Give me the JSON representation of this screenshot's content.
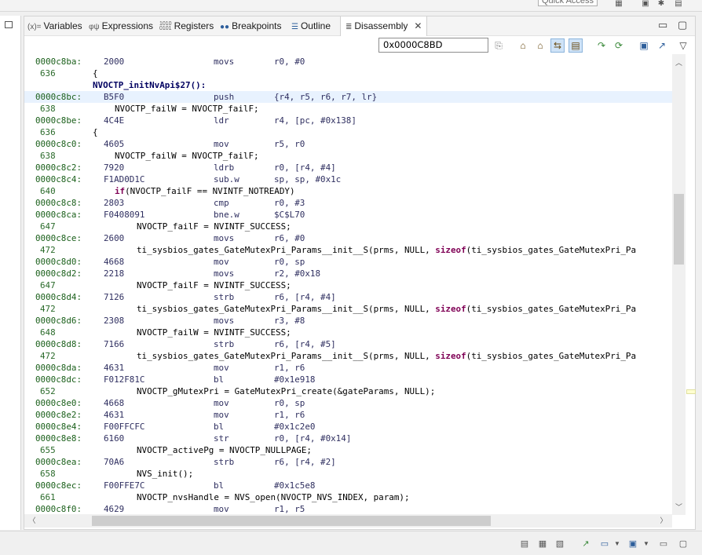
{
  "quick_access": {
    "placeholder": "Quick Access"
  },
  "tabs": [
    {
      "label": "Variables",
      "icon": "variables-icon",
      "glyph": "(x)="
    },
    {
      "label": "Expressions",
      "icon": "expressions-icon",
      "glyph": "φψ"
    },
    {
      "label": "Registers",
      "icon": "registers-icon",
      "glyph": "1010\n0101"
    },
    {
      "label": "Breakpoints",
      "icon": "breakpoints-icon",
      "glyph": "●●"
    },
    {
      "label": "Outline",
      "icon": "outline-icon",
      "glyph": "☰"
    },
    {
      "label": "Disassembly",
      "icon": "disassembly-icon",
      "glyph": "≣",
      "active": true
    }
  ],
  "address_input": {
    "value": "0x0000C8BD"
  },
  "disassembly": {
    "current_address": "0000c8bc:",
    "lines": [
      {
        "kind": "asm",
        "addr": "0000c8ba:",
        "opcode": "2000",
        "mnemonic": "movs",
        "operands": "r0, #0"
      },
      {
        "kind": "src",
        "lnum": "636",
        "code": "{",
        "indent": 0
      },
      {
        "kind": "func",
        "code": "NVOCTP_initNvApi$27():"
      },
      {
        "kind": "asm",
        "addr": "0000c8bc:",
        "opcode": "B5F0",
        "mnemonic": "push",
        "operands": "{r4, r5, r6, r7, lr}",
        "current": true
      },
      {
        "kind": "src",
        "lnum": "638",
        "code": "NVOCTP_failW = NVOCTP_failF;",
        "indent": 1
      },
      {
        "kind": "asm",
        "addr": "0000c8be:",
        "opcode": "4C4E",
        "mnemonic": "ldr",
        "operands": "r4, [pc, #0x138]"
      },
      {
        "kind": "src",
        "lnum": "636",
        "code": "{",
        "indent": 0
      },
      {
        "kind": "asm",
        "addr": "0000c8c0:",
        "opcode": "4605",
        "mnemonic": "mov",
        "operands": "r5, r0"
      },
      {
        "kind": "src",
        "lnum": "638",
        "code": "NVOCTP_failW = NVOCTP_failF;",
        "indent": 1
      },
      {
        "kind": "asm",
        "addr": "0000c8c2:",
        "opcode": "7920",
        "mnemonic": "ldrb",
        "operands": "r0, [r4, #4]"
      },
      {
        "kind": "asm",
        "addr": "0000c8c4:",
        "opcode": "F1AD0D1C",
        "mnemonic": "sub.w",
        "operands": "sp, sp, #0x1c"
      },
      {
        "kind": "src",
        "lnum": "640",
        "code": "if(NVOCTP_failF == NVINTF_NOTREADY)",
        "indent": 1,
        "kw": "if"
      },
      {
        "kind": "asm",
        "addr": "0000c8c8:",
        "opcode": "2803",
        "mnemonic": "cmp",
        "operands": "r0, #3"
      },
      {
        "kind": "asm",
        "addr": "0000c8ca:",
        "opcode": "F0408091",
        "mnemonic": "bne.w",
        "operands": "$C$L70"
      },
      {
        "kind": "src",
        "lnum": "647",
        "code": "NVOCTP_failF = NVINTF_SUCCESS;",
        "indent": 2
      },
      {
        "kind": "asm",
        "addr": "0000c8ce:",
        "opcode": "2600",
        "mnemonic": "movs",
        "operands": "r6, #0"
      },
      {
        "kind": "src",
        "lnum": "472",
        "code": "ti_sysbios_gates_GateMutexPri_Params__init__S(prms, NULL, ",
        "kw_tail": "sizeof",
        "tail": "(ti_sysbios_gates_GateMutexPri_Pa",
        "indent": 2
      },
      {
        "kind": "asm",
        "addr": "0000c8d0:",
        "opcode": "4668",
        "mnemonic": "mov",
        "operands": "r0, sp"
      },
      {
        "kind": "asm",
        "addr": "0000c8d2:",
        "opcode": "2218",
        "mnemonic": "movs",
        "operands": "r2, #0x18"
      },
      {
        "kind": "src",
        "lnum": "647",
        "code": "NVOCTP_failF = NVINTF_SUCCESS;",
        "indent": 2
      },
      {
        "kind": "asm",
        "addr": "0000c8d4:",
        "opcode": "7126",
        "mnemonic": "strb",
        "operands": "r6, [r4, #4]"
      },
      {
        "kind": "src",
        "lnum": "472",
        "code": "ti_sysbios_gates_GateMutexPri_Params__init__S(prms, NULL, ",
        "kw_tail": "sizeof",
        "tail": "(ti_sysbios_gates_GateMutexPri_Pa",
        "indent": 2
      },
      {
        "kind": "asm",
        "addr": "0000c8d6:",
        "opcode": "2308",
        "mnemonic": "movs",
        "operands": "r3, #8"
      },
      {
        "kind": "src",
        "lnum": "648",
        "code": "NVOCTP_failW = NVINTF_SUCCESS;",
        "indent": 2
      },
      {
        "kind": "asm",
        "addr": "0000c8d8:",
        "opcode": "7166",
        "mnemonic": "strb",
        "operands": "r6, [r4, #5]"
      },
      {
        "kind": "src",
        "lnum": "472",
        "code": "ti_sysbios_gates_GateMutexPri_Params__init__S(prms, NULL, ",
        "kw_tail": "sizeof",
        "tail": "(ti_sysbios_gates_GateMutexPri_Pa",
        "indent": 2
      },
      {
        "kind": "asm",
        "addr": "0000c8da:",
        "opcode": "4631",
        "mnemonic": "mov",
        "operands": "r1, r6"
      },
      {
        "kind": "asm",
        "addr": "0000c8dc:",
        "opcode": "F012F81C",
        "mnemonic": "bl",
        "operands": "#0x1e918"
      },
      {
        "kind": "src",
        "lnum": "652",
        "code": "NVOCTP_gMutexPri = GateMutexPri_create(&gateParams, NULL);",
        "indent": 2
      },
      {
        "kind": "asm",
        "addr": "0000c8e0:",
        "opcode": "4668",
        "mnemonic": "mov",
        "operands": "r0, sp"
      },
      {
        "kind": "asm",
        "addr": "0000c8e2:",
        "opcode": "4631",
        "mnemonic": "mov",
        "operands": "r1, r6"
      },
      {
        "kind": "asm",
        "addr": "0000c8e4:",
        "opcode": "F00FFCFC",
        "mnemonic": "bl",
        "operands": "#0x1c2e0"
      },
      {
        "kind": "asm",
        "addr": "0000c8e8:",
        "opcode": "6160",
        "mnemonic": "str",
        "operands": "r0, [r4, #0x14]"
      },
      {
        "kind": "src",
        "lnum": "655",
        "code": "NVOCTP_activePg = NVOCTP_NULLPAGE;",
        "indent": 2
      },
      {
        "kind": "asm",
        "addr": "0000c8ea:",
        "opcode": "70A6",
        "mnemonic": "strb",
        "operands": "r6, [r4, #2]"
      },
      {
        "kind": "src",
        "lnum": "658",
        "code": "NVS_init();",
        "indent": 2
      },
      {
        "kind": "asm",
        "addr": "0000c8ec:",
        "opcode": "F00FFE7C",
        "mnemonic": "bl",
        "operands": "#0x1c5e8"
      },
      {
        "kind": "src",
        "lnum": "661",
        "code": "NVOCTP_nvsHandle = NVS_open(NVOCTP_NVS_INDEX, param);",
        "indent": 2
      },
      {
        "kind": "asm",
        "addr": "0000c8f0:",
        "opcode": "4629",
        "mnemonic": "mov",
        "operands": "r1, r5"
      }
    ]
  },
  "scroll": {
    "vertical_fraction": 0.3,
    "horizontal_fraction": 0.1
  }
}
